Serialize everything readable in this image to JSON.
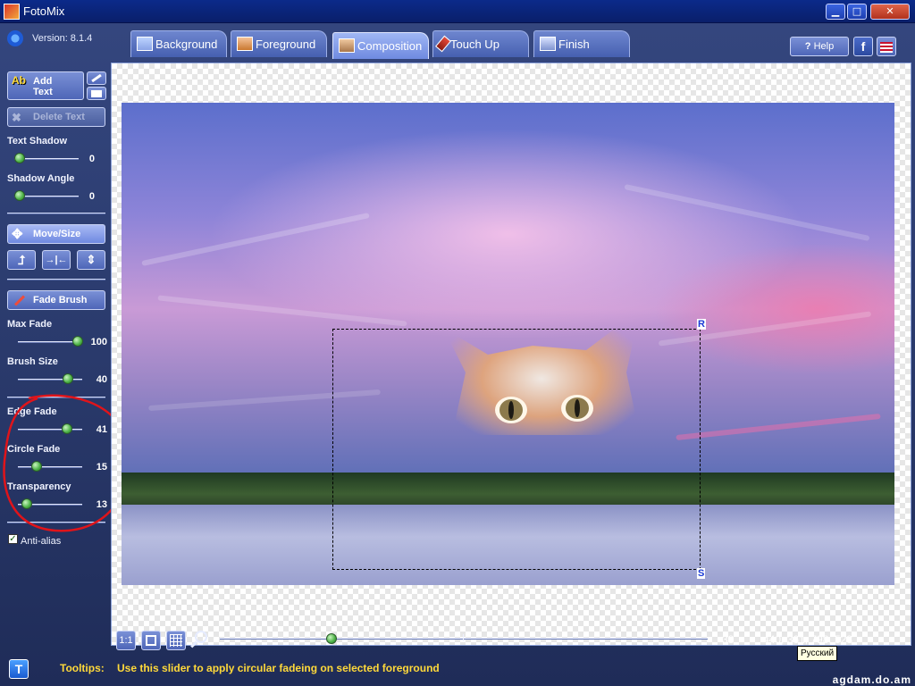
{
  "window": {
    "title": "FotoMix",
    "minimize_label": "▁",
    "maximize_label": "□",
    "close_label": "✕"
  },
  "header": {
    "version": "Version: 8.1.4",
    "tabs": [
      {
        "label": "Background",
        "icon": "landscape-icon"
      },
      {
        "label": "Foreground",
        "icon": "portrait-icon"
      },
      {
        "label": "Composition",
        "icon": "composition-icon",
        "active": true
      },
      {
        "label": "Touch Up",
        "icon": "brush-icon"
      },
      {
        "label": "Finish",
        "icon": "save-icon"
      }
    ],
    "help_label": "Help",
    "facebook_label": "f"
  },
  "panel": {
    "add_text_label": "Add Text",
    "delete_text_label": "Delete Text",
    "text_shadow": {
      "label": "Text Shadow",
      "value": "0"
    },
    "shadow_angle": {
      "label": "Shadow Angle",
      "value": "0"
    },
    "move_size_label": "Move/Size",
    "fade_brush_label": "Fade Brush",
    "max_fade": {
      "label": "Max Fade",
      "value": "100"
    },
    "brush_size": {
      "label": "Brush Size",
      "value": "40"
    },
    "edge_fade": {
      "label": "Edge Fade",
      "value": "41"
    },
    "circle_fade": {
      "label": "Circle Fade",
      "value": "15"
    },
    "transparency": {
      "label": "Transparency",
      "value": "13"
    },
    "anti_alias": {
      "label": "Anti-alias",
      "checked": true
    }
  },
  "canvas": {
    "handle_r": "R",
    "handle_s": "S"
  },
  "bottom": {
    "zoom_value": "-38",
    "coordinates": "440, 361, 798, 523",
    "language_tooltip": "Русский",
    "tooltips_label": "Tooltips:",
    "tooltip_text": "Use this slider to apply circular fadeing on selected foreground",
    "watermark": "agdam.do.am"
  },
  "colors": {
    "accent": "#4e66b8",
    "tooltip_text": "#ffd93a",
    "slider_knob": "#49b043",
    "annotation": "#e0141a"
  }
}
